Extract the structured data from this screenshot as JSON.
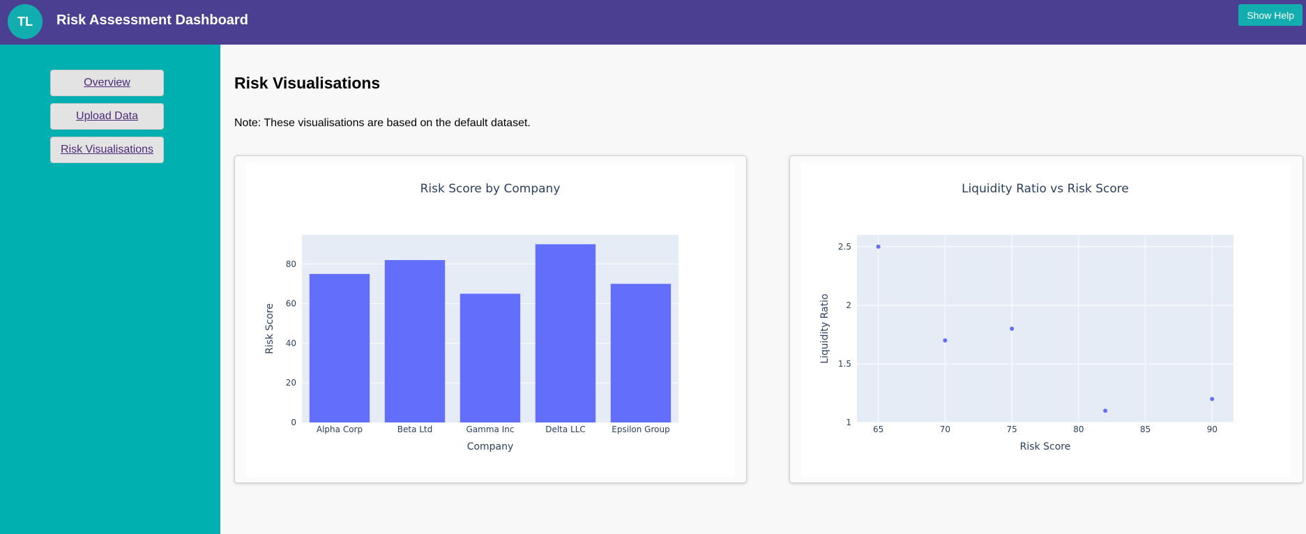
{
  "header": {
    "logo_text": "TL",
    "title": "Risk Assessment Dashboard",
    "help_label": "Show Help"
  },
  "sidebar": {
    "items": [
      {
        "label": "Overview"
      },
      {
        "label": "Upload Data"
      },
      {
        "label": "Risk Visualisations"
      }
    ]
  },
  "main": {
    "title": "Risk Visualisations",
    "note": "Note: These visualisations are based on the default dataset."
  },
  "colors": {
    "header_bg": "#4b3f91",
    "sidebar_bg": "#00b0b0",
    "accent": "#12aeaf",
    "plot_bg": "#e5ecf6",
    "mark": "#636efa"
  },
  "chart_data": [
    {
      "type": "bar",
      "title": "Risk Score by Company",
      "xlabel": "Company",
      "ylabel": "Risk Score",
      "categories": [
        "Alpha Corp",
        "Beta Ltd",
        "Gamma Inc",
        "Delta LLC",
        "Epsilon Group"
      ],
      "values": [
        75,
        82,
        65,
        90,
        70
      ],
      "ylim": [
        0,
        94.7
      ],
      "yticks": [
        0,
        20,
        40,
        60,
        80
      ],
      "grid": true
    },
    {
      "type": "scatter",
      "title": "Liquidity Ratio vs Risk Score",
      "xlabel": "Risk Score",
      "ylabel": "Liquidity Ratio",
      "x": [
        65,
        70,
        75,
        82,
        90
      ],
      "y": [
        2.5,
        1.7,
        1.8,
        1.1,
        1.2
      ],
      "xlim": [
        63.4,
        91.6
      ],
      "ylim": [
        1,
        2.6
      ],
      "xticks": [
        65,
        70,
        75,
        80,
        85,
        90
      ],
      "yticks": [
        1,
        1.5,
        2,
        2.5
      ],
      "grid": true
    }
  ]
}
